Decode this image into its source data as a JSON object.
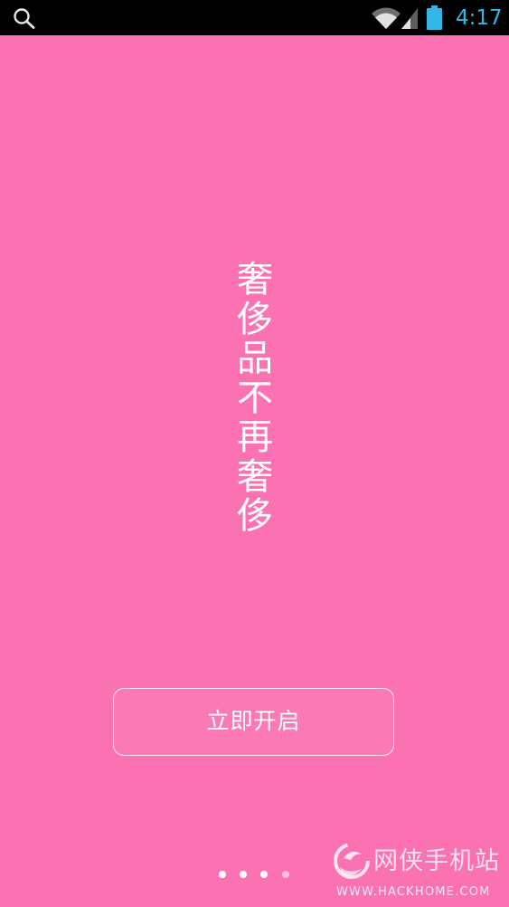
{
  "status_bar": {
    "time": "4:17",
    "time_color": "#33B5E5",
    "icons": [
      "search-icon",
      "wifi-icon",
      "signal-icon",
      "battery-icon"
    ]
  },
  "splash": {
    "background_color": "#FB72B2",
    "slogan": "奢侈品不再奢侈"
  },
  "start_button": {
    "label": "立即开启"
  },
  "pager": {
    "total": 4,
    "active_indices": [
      0,
      1,
      2
    ]
  },
  "watermark": {
    "title": "网侠手机站",
    "url": "WWW.HACKHOME.COM"
  }
}
